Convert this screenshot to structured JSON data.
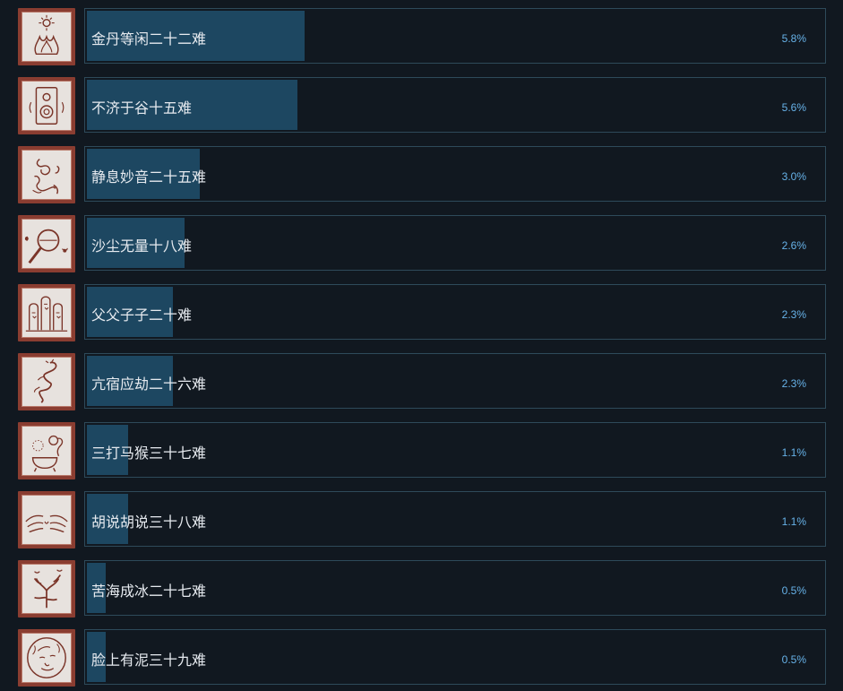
{
  "achievements": [
    {
      "name": "金丹等闲二十二难",
      "percent_label": "5.8%",
      "percent": 5.8,
      "icon": "flame-sun-icon"
    },
    {
      "name": "不济于谷十五难",
      "percent_label": "5.6%",
      "percent": 5.6,
      "icon": "speaker-icon"
    },
    {
      "name": "静息妙音二十五难",
      "percent_label": "3.0%",
      "percent": 3.0,
      "icon": "swirl-creature-icon"
    },
    {
      "name": "沙尘无量十八难",
      "percent_label": "2.6%",
      "percent": 2.6,
      "icon": "hand-drum-icon"
    },
    {
      "name": "父父子子二十难",
      "percent_label": "2.3%",
      "percent": 2.3,
      "icon": "tombstones-icon"
    },
    {
      "name": "亢宿应劫二十六难",
      "percent_label": "2.3%",
      "percent": 2.3,
      "icon": "serpent-icon"
    },
    {
      "name": "三打马猴三十七难",
      "percent_label": "1.1%",
      "percent": 1.1,
      "icon": "monkey-cauldron-icon"
    },
    {
      "name": "胡说胡说三十八难",
      "percent_label": "1.1%",
      "percent": 1.1,
      "icon": "whiskers-icon"
    },
    {
      "name": "苦海成冰二十七难",
      "percent_label": "0.5%",
      "percent": 0.5,
      "icon": "coral-tree-icon"
    },
    {
      "name": "脸上有泥三十九难",
      "percent_label": "0.5%",
      "percent": 0.5,
      "icon": "muddy-face-icon"
    }
  ],
  "colors": {
    "background": "#111820",
    "bar_fill": "#1d4761",
    "bar_border": "#2e4a5a",
    "percent_text": "#67b2e8",
    "name_text": "#e6eaef",
    "icon_frame": "#8a3d31"
  }
}
